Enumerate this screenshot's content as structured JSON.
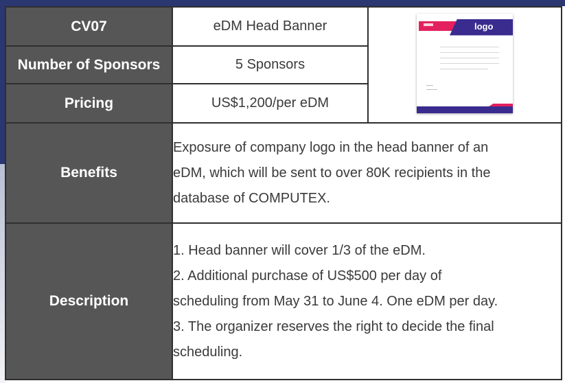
{
  "rows": {
    "code": "CV07",
    "item": "eDM Head Banner",
    "sponsors_label": "Number of Sponsors",
    "sponsors_value": "5 Sponsors",
    "pricing_label": "Pricing",
    "pricing_value": "US$1,200/per eDM",
    "benefits_label": "Benefits",
    "benefits_lines": [
      "Exposure of company logo in the head banner of an",
      "eDM, which will be sent to over 80K recipients in the",
      "database of COMPUTEX."
    ],
    "description_label": "Description",
    "description_lines": [
      "1. Head banner will cover 1/3 of the eDM.",
      "2. Additional purchase of US$500 per day of",
      "scheduling from May 31 to June 4. One eDM per day.",
      "3. The organizer reserves the right to decide the final",
      "scheduling."
    ]
  },
  "preview": {
    "logo_text": "logo",
    "accent_pink": "#e4205f",
    "accent_purple": "#3a2b8f"
  },
  "colors": {
    "header_bg": "#565656",
    "frame": "#2a3770"
  }
}
